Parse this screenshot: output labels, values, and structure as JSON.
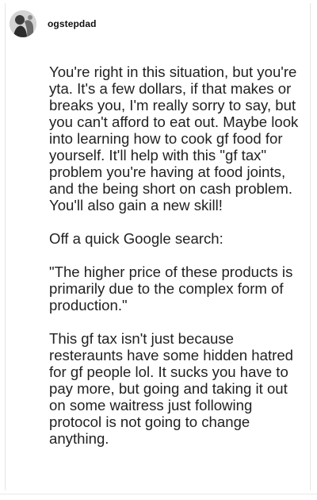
{
  "post": {
    "username": "ogstepdad",
    "avatar_icon": "user-avatar-photo",
    "paragraphs": [
      "You're right in this situation, but you're yta. It's a few dollars, if that makes or breaks you, I'm really sorry to say, but you can't afford to eat out. Maybe look into learning how to cook gf food for yourself. It'll help with this \"gf tax\" problem you're having at food joints, and the being short on cash problem. You'll also gain a new skill!",
      "Off a quick Google search:",
      "\"The higher price of these products is primarily due to the complex form of production.\"",
      "This gf tax isn't just because resteraunts have some hidden hatred for gf people lol. It sucks you have to pay more, but going and taking it out on some waitress just following protocol is not going to change anything."
    ]
  }
}
